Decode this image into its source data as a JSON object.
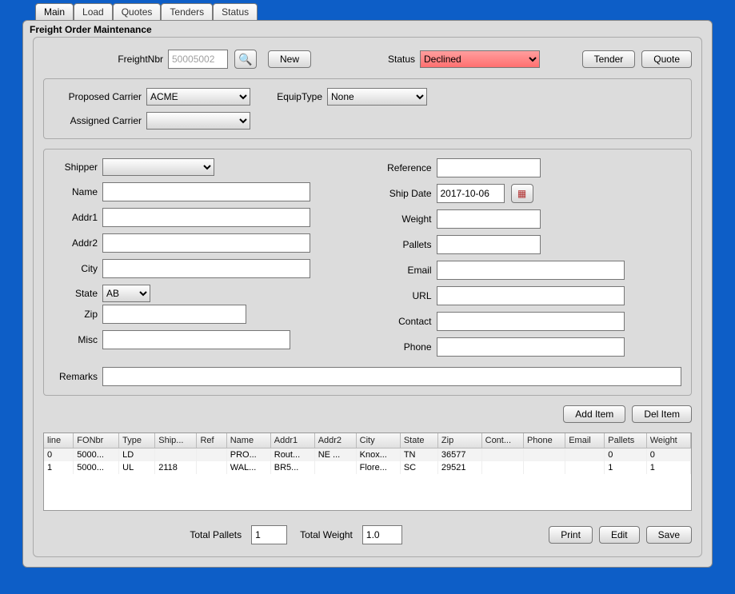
{
  "tabs": [
    "Main",
    "Load",
    "Quotes",
    "Tenders",
    "Status"
  ],
  "activeTab": "Main",
  "panelTitle": "Freight Order Maintenance",
  "top": {
    "freightNbrLabel": "FreightNbr",
    "freightNbrValue": "50005002",
    "newLabel": "New",
    "statusLabel": "Status",
    "statusValue": "Declined",
    "tenderLabel": "Tender",
    "quoteLabel": "Quote"
  },
  "carrier": {
    "proposedLabel": "Proposed Carrier",
    "proposedValue": "ACME",
    "assignedLabel": "Assigned Carrier",
    "assignedValue": "",
    "equipTypeLabel": "EquipType",
    "equipTypeValue": "None"
  },
  "shipper": {
    "shipperLabel": "Shipper",
    "nameLabel": "Name",
    "addr1Label": "Addr1",
    "addr2Label": "Addr2",
    "cityLabel": "City",
    "stateLabel": "State",
    "stateValue": "AB",
    "zipLabel": "Zip",
    "miscLabel": "Misc",
    "referenceLabel": "Reference",
    "shipDateLabel": "Ship Date",
    "shipDateValue": "2017-10-06",
    "weightLabel": "Weight",
    "palletsLabel": "Pallets",
    "emailLabel": "Email",
    "urlLabel": "URL",
    "contactLabel": "Contact",
    "phoneLabel": "Phone",
    "remarksLabel": "Remarks"
  },
  "items": {
    "addLabel": "Add Item",
    "delLabel": "Del Item",
    "cols": [
      "line",
      "FONbr",
      "Type",
      "Ship...",
      "Ref",
      "Name",
      "Addr1",
      "Addr2",
      "City",
      "State",
      "Zip",
      "Cont...",
      "Phone",
      "Email",
      "Pallets",
      "Weight"
    ],
    "rows": [
      {
        "line": "0",
        "fonbr": "5000...",
        "type": "LD",
        "ship": "",
        "ref": "",
        "name": "PRO...",
        "addr1": "Rout...",
        "addr2": "NE ...",
        "city": "Knox...",
        "state": "TN",
        "zip": "36577",
        "cont": "",
        "phone": "",
        "email": "",
        "pallets": "0",
        "weight": "0"
      },
      {
        "line": "1",
        "fonbr": "5000...",
        "type": "UL",
        "ship": "2118",
        "ref": "",
        "name": "WAL...",
        "addr1": "BR5...",
        "addr2": "",
        "city": "Flore...",
        "state": "SC",
        "zip": "29521",
        "cont": "",
        "phone": "",
        "email": "",
        "pallets": "1",
        "weight": "1"
      }
    ]
  },
  "footer": {
    "totalPalletsLabel": "Total Pallets",
    "totalPalletsValue": "1",
    "totalWeightLabel": "Total Weight",
    "totalWeightValue": "1.0",
    "printLabel": "Print",
    "editLabel": "Edit",
    "saveLabel": "Save"
  }
}
